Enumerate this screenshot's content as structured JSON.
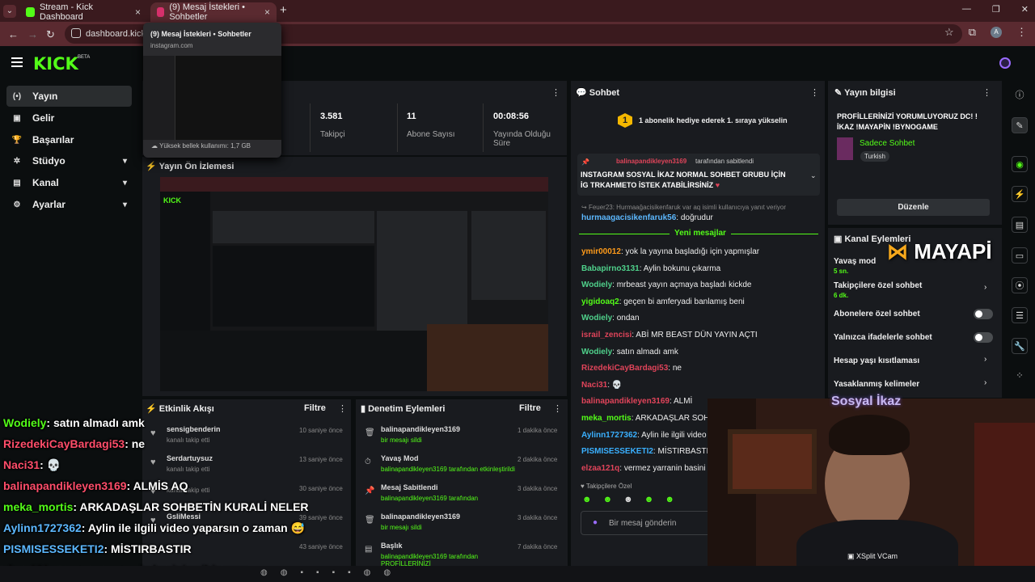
{
  "browser": {
    "tab1": {
      "title": "Stream - Kick Dashboard",
      "close": "×"
    },
    "tab2": {
      "title": "(9) Mesaj İstekleri • Sohbetler",
      "close": "×"
    },
    "new_tab": "+",
    "url": "dashboard.kick.com",
    "profile_initial": "A",
    "hover_card": {
      "title": "(9) Mesaj İstekleri • Sohbetler",
      "url": "instagram.com",
      "memory": "Yüksek bellek kullanımı: 1,7 GB"
    }
  },
  "kick": {
    "logo": "KICK",
    "beta": "BETA",
    "sidebar": [
      {
        "label": "Yayın",
        "icon": "(•)",
        "icon_name": "broadcast-icon",
        "active": true,
        "expand": false
      },
      {
        "label": "Gelir",
        "icon": "▣",
        "icon_name": "revenue-icon",
        "active": false,
        "expand": false
      },
      {
        "label": "Başarılar",
        "icon": "🏆",
        "icon_name": "trophy-icon",
        "active": false,
        "expand": false
      },
      {
        "label": "Stüdyo",
        "icon": "✲",
        "icon_name": "studio-icon",
        "active": false,
        "expand": true
      },
      {
        "label": "Kanal",
        "icon": "▤",
        "icon_name": "channel-icon",
        "active": false,
        "expand": true
      },
      {
        "label": "Ayarlar",
        "icon": "⚙",
        "icon_name": "settings-icon",
        "active": false,
        "expand": true
      }
    ]
  },
  "stats": [
    {
      "value": "3.581",
      "label": "Takipçi"
    },
    {
      "value": "11",
      "label": "Abone Sayısı"
    },
    {
      "value": "00:08:56",
      "label": "Yayında Olduğu Süre"
    }
  ],
  "preview": {
    "title": "Yayın Ön İzlemesi"
  },
  "chat": {
    "title": "Sohbet",
    "gift_banner": "1 abonelik hediye ederek 1. sıraya yükselin",
    "gift_rank": "1",
    "pinned_by_user": "balinapandikleyen3169",
    "pinned_by_suffix": "tarafından sabitlendi",
    "pinned_text": "INSTAGRAM SOSYAL İKAZ NORMAL SOHBET GRUBU İÇİN İG TRKAHMETO İSTEK ATABİLİRSİNİZ",
    "reply_note": "Feuer23: Hurmaağacisikenfaruk var aq isimli kullanıcıya yanıt veriyor",
    "reply_user": "hurmaagacisikenfaruk56",
    "reply_msg": ": doğrudur",
    "new_messages": "Yeni mesajlar",
    "messages": [
      {
        "user": "ymir00012",
        "text": ": yok la yayına başladığı için yapmışlar",
        "color": "#ff9b1a"
      },
      {
        "user": "Babapirno3131",
        "text": ": Aylin bokunu çıkarma",
        "color": "#4fd18b"
      },
      {
        "user": "Wodiely",
        "text": ": mrbeast yayın açmaya başladı kickde",
        "color": "#4fd18b"
      },
      {
        "user": "yigidoaq2",
        "text": ": geçen bi amferyadi banlamış beni",
        "color": "#53fc18"
      },
      {
        "user": "Wodiely",
        "text": ": ondan",
        "color": "#4fd18b"
      },
      {
        "user": "israil_zencisi",
        "text": ": ABİ MR BEAST DÜN YAYIN AÇTI",
        "color": "#e0445a"
      },
      {
        "user": "Wodiely",
        "text": ": satın almadı amk",
        "color": "#4fd18b"
      },
      {
        "user": "RizedekiCayBardagi53",
        "text": ": ne",
        "color": "#e0445a"
      },
      {
        "user": "Naci31",
        "text": ": 💀",
        "color": "#e0445a"
      },
      {
        "user": "balinapandikleyen3169",
        "text": ": ALMİ",
        "color": "#e0445a"
      },
      {
        "user": "meka_mortis",
        "text": ": ARKADAŞLAR SOHBET",
        "color": "#53fc18"
      },
      {
        "user": "Aylinn1727362",
        "text": ": Aylin ile ilgili video y",
        "color": "#3ab0ff"
      },
      {
        "user": "PISMISESSEKETI2",
        "text": ": MİSTIRBASTIR",
        "color": "#3ab0ff"
      },
      {
        "user": "elzaa121q",
        "text": ": vermez yarranin basini vei",
        "color": "#e0445a"
      }
    ],
    "follower_only": "Takipçilere Özel",
    "input_placeholder": "Bir mesaj gönderin"
  },
  "stream_info": {
    "title_label": "Yayın bilgisi",
    "stream_title": "PROFİLLERİNİZİ YORUMLUYORUZ DC! ! İKAZ !MAYAPİN !BYNOGAME",
    "category": "Sadece Sohbet",
    "tag": "Turkish",
    "edit": "Düzenle"
  },
  "channel_actions": {
    "title": "Kanal Eylemleri",
    "rows": [
      {
        "label": "Yavaş mod",
        "sub": "5 sn."
      },
      {
        "label": "Takipçilere özel sohbet",
        "sub": "6 dk."
      },
      {
        "label": "Abonelere özel sohbet",
        "sub": ""
      },
      {
        "label": "Yalnızca ifadelerle sohbet",
        "sub": ""
      },
      {
        "label": "Hesap yaşı kısıtlaması",
        "sub": ""
      },
      {
        "label": "Yasaklanmış kelimeler",
        "sub": ""
      }
    ]
  },
  "activity": {
    "title": "Etkinlik Akışı",
    "filter": "Filtre",
    "events": [
      {
        "name": "sensigbenderin",
        "desc": "kanalı takip etti",
        "time": "10 saniye önce"
      },
      {
        "name": "Serdartuysuz",
        "desc": "kanalı takip etti",
        "time": "13 saniye önce"
      },
      {
        "name": "",
        "desc": "kanalı takip etti",
        "time": "30 saniye önce"
      },
      {
        "name": "GsliMessi",
        "desc": "",
        "time": "39 saniye önce"
      },
      {
        "name": "",
        "desc": "",
        "time": "43 saniye önce"
      }
    ]
  },
  "moderation": {
    "title": "Denetim Eylemleri",
    "filter": "Filtre",
    "events": [
      {
        "name": "balinapandikleyen3169",
        "desc": "bir mesajı sildi",
        "time": "1 dakika önce"
      },
      {
        "name": "Yavaş Mod",
        "desc": "balinapandikleyen3169 tarafından etkinleştirildi",
        "time": "2 dakika önce"
      },
      {
        "name": "Mesaj Sabitlendi",
        "desc": "balinapandikleyen3169 tarafından",
        "time": "3 dakika önce"
      },
      {
        "name": "balinapandikleyen3169",
        "desc": "bir mesajı sildi",
        "time": "3 dakika önce"
      },
      {
        "name": "Başlık",
        "desc": "balinapandikleyen3169 tarafından PROFİLLERİNİZİ",
        "time": "7 dakika önce"
      }
    ]
  },
  "overlay_chat": [
    {
      "user": "Wodiely",
      "msg": ": satın almadı amk",
      "color": "#53fc18"
    },
    {
      "user": "RizedekiCayBardagi53",
      "msg": ": ne",
      "color": "#ff4d6a"
    },
    {
      "user": "Naci31",
      "msg": ": 💀",
      "color": "#ff4d6a"
    },
    {
      "user": "balinapandikleyen3169",
      "msg": ": ALMİS AQ",
      "color": "#ff4d6a"
    },
    {
      "user": "meka_mortis",
      "msg": ": ARKADAŞLAR SOHBETİN KURALİ NELER",
      "color": "#53fc18"
    },
    {
      "user": "Aylinn1727362",
      "msg": ": Aylin ile ilgili video yaparsın o zaman 😅",
      "color": "#5cb8ff"
    },
    {
      "user": "PISMISESSEKETI2",
      "msg": ": MİSTIRBASTIR",
      "color": "#5cb8ff"
    },
    {
      "user": "elzaa121q",
      "msg": ": vermez yarranin basini veilrir sana",
      "color": "#ff4d6a"
    }
  ],
  "overlay": {
    "cam_title": "Sosyal İkaz",
    "xsplit": "XSplit VCam",
    "mayapin": "MAYAPİ"
  },
  "colors": {
    "kick_green": "#53fc18",
    "panel": "#191b1f",
    "tab_bar": "#3a1a1e"
  }
}
